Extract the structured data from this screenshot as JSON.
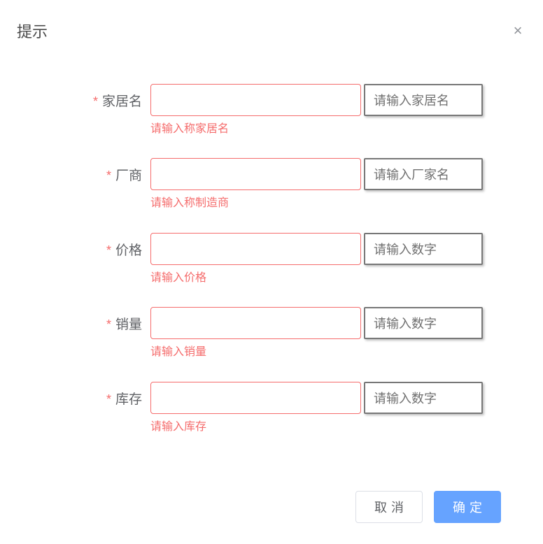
{
  "dialog": {
    "title": "提示",
    "close_label": "×"
  },
  "form": {
    "fields": [
      {
        "label": "家居名",
        "value": "",
        "append": "请输入家居名",
        "error": "请输入称家居名"
      },
      {
        "label": "厂商",
        "value": "",
        "append": "请输入厂家名",
        "error": "请输入称制造商"
      },
      {
        "label": "价格",
        "value": "",
        "append": "请输入数字",
        "error": "请输入价格"
      },
      {
        "label": "销量",
        "value": "",
        "append": "请输入数字",
        "error": "请输入销量"
      },
      {
        "label": "库存",
        "value": "",
        "append": "请输入数字",
        "error": "请输入库存"
      }
    ]
  },
  "footer": {
    "cancel_label": "取消",
    "confirm_label": "确定"
  }
}
